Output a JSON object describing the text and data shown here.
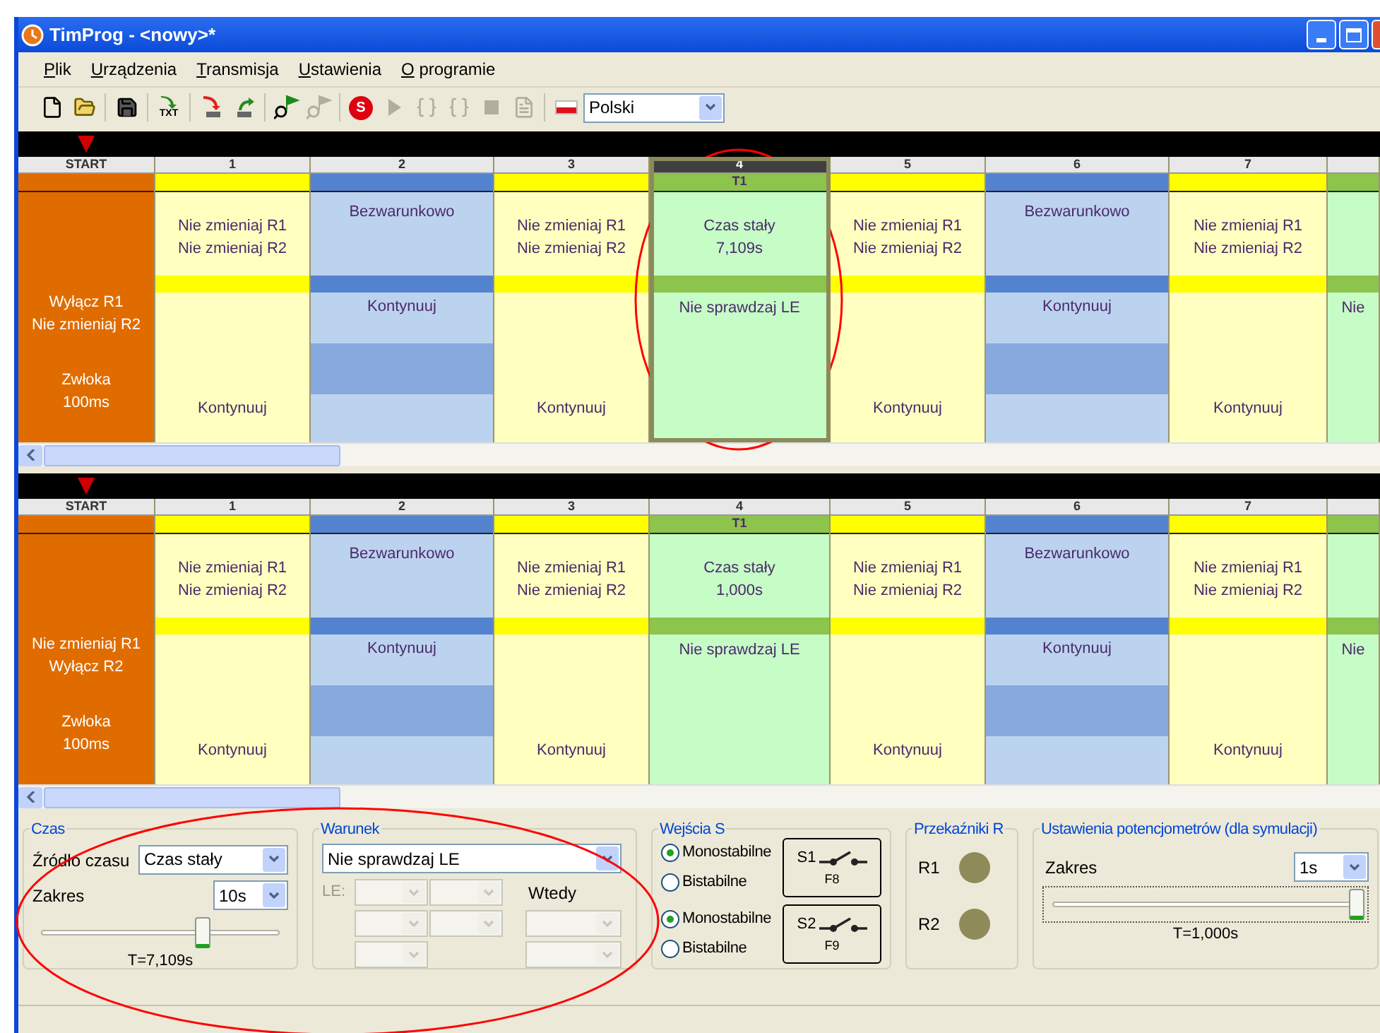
{
  "window": {
    "title": "TimProg - <nowy>*"
  },
  "menu": [
    "Plik",
    "Urządzenia",
    "Transmisja",
    "Ustawienia",
    "O programie"
  ],
  "toolbar": [
    {
      "kind": "new",
      "disabled": false
    },
    {
      "kind": "open",
      "disabled": false
    },
    {
      "kind": "separator"
    },
    {
      "kind": "save",
      "disabled": false
    },
    {
      "kind": "separator"
    },
    {
      "kind": "txt",
      "label": "TXT",
      "disabled": false
    },
    {
      "kind": "separator"
    },
    {
      "kind": "download",
      "disabled": false
    },
    {
      "kind": "upload",
      "disabled": false
    },
    {
      "kind": "separator"
    },
    {
      "kind": "find",
      "disabled": false
    },
    {
      "kind": "find",
      "disabled": true
    },
    {
      "kind": "separator"
    },
    {
      "kind": "stop",
      "label": "S",
      "disabled": false
    },
    {
      "kind": "play",
      "disabled": true
    },
    {
      "kind": "step-in",
      "disabled": true
    },
    {
      "kind": "step-out",
      "disabled": true
    },
    {
      "kind": "square",
      "disabled": true
    },
    {
      "kind": "doc",
      "disabled": true
    },
    {
      "kind": "separator"
    },
    {
      "kind": "flag",
      "disabled": false
    }
  ],
  "language": {
    "value": "Polski"
  },
  "programs": [
    {
      "columns": [
        {
          "kind": "start",
          "header": "START",
          "selected": false,
          "top": [
            "Wyłącz R1",
            "Nie zmieniaj R2"
          ],
          "bottom": [
            "Zwłoka",
            "100ms"
          ]
        },
        {
          "kind": "relay",
          "header": "1",
          "selected": false,
          "top": [
            "Nie zmieniaj R1",
            "Nie zmieniaj R2"
          ],
          "bottom": [
            "Kontynuuj"
          ]
        },
        {
          "kind": "condition",
          "header": "2",
          "selected": false,
          "top": [
            "Bezwarunkowo"
          ],
          "bottom": [
            "Kontynuuj"
          ]
        },
        {
          "kind": "relay",
          "header": "3",
          "selected": false,
          "top": [
            "Nie zmieniaj R1",
            "Nie zmieniaj R2"
          ],
          "bottom": [
            "Kontynuuj"
          ]
        },
        {
          "kind": "time",
          "header": "4",
          "tag": "T1",
          "selected": true,
          "top": [
            "Czas stały",
            "7,109s"
          ],
          "bottom": [
            "Nie sprawdzaj LE"
          ]
        },
        {
          "kind": "relay",
          "header": "5",
          "selected": false,
          "top": [
            "Nie zmieniaj R1",
            "Nie zmieniaj R2"
          ],
          "bottom": [
            "Kontynuuj"
          ]
        },
        {
          "kind": "condition",
          "header": "6",
          "selected": false,
          "top": [
            "Bezwarunkowo"
          ],
          "bottom": [
            "Kontynuuj"
          ]
        },
        {
          "kind": "relay",
          "header": "7",
          "selected": false,
          "top": [
            "Nie zmieniaj R1",
            "Nie zmieniaj R2"
          ],
          "bottom": [
            "Kontynuuj"
          ]
        },
        {
          "kind": "time",
          "selected": false,
          "bottom": [
            "Nie"
          ]
        }
      ]
    },
    {
      "columns": [
        {
          "kind": "start",
          "header": "START",
          "selected": false,
          "top": [
            "Nie zmieniaj R1",
            "Wyłącz R2"
          ],
          "bottom": [
            "Zwłoka",
            "100ms"
          ]
        },
        {
          "kind": "relay",
          "header": "1",
          "selected": false,
          "top": [
            "Nie zmieniaj R1",
            "Nie zmieniaj R2"
          ],
          "bottom": [
            "Kontynuuj"
          ]
        },
        {
          "kind": "condition",
          "header": "2",
          "selected": false,
          "top": [
            "Bezwarunkowo"
          ],
          "bottom": [
            "Kontynuuj"
          ]
        },
        {
          "kind": "relay",
          "header": "3",
          "selected": false,
          "top": [
            "Nie zmieniaj R1",
            "Nie zmieniaj R2"
          ],
          "bottom": [
            "Kontynuuj"
          ]
        },
        {
          "kind": "time",
          "header": "4",
          "tag": "T1",
          "selected": false,
          "top": [
            "Czas stały",
            "1,000s"
          ],
          "bottom": [
            "Nie sprawdzaj LE"
          ]
        },
        {
          "kind": "relay",
          "header": "5",
          "selected": false,
          "top": [
            "Nie zmieniaj R1",
            "Nie zmieniaj R2"
          ],
          "bottom": [
            "Kontynuuj"
          ]
        },
        {
          "kind": "condition",
          "header": "6",
          "selected": false,
          "top": [
            "Bezwarunkowo"
          ],
          "bottom": [
            "Kontynuuj"
          ]
        },
        {
          "kind": "relay",
          "header": "7",
          "selected": false,
          "top": [
            "Nie zmieniaj R1",
            "Nie zmieniaj R2"
          ],
          "bottom": [
            "Kontynuuj"
          ]
        },
        {
          "kind": "time",
          "selected": false,
          "bottom": [
            "Nie"
          ]
        }
      ]
    }
  ],
  "time_group": {
    "title": "Czas",
    "source_label": "Źródło czasu",
    "source": "Czas stały",
    "range_label": "Zakres",
    "range": "10s",
    "level": 0.68,
    "reading": "T=7,109s"
  },
  "condition_group": {
    "title": "Warunek",
    "condition": "Nie sprawdzaj LE",
    "le_label": "LE:",
    "disabled": true,
    "then_label": "Wtedy"
  },
  "inputs_group": {
    "title": "Wejścia S",
    "inputs": [
      {
        "radios": [
          {
            "label": "Monostabilne",
            "selected": true
          },
          {
            "label": "Bistabilne",
            "selected": false
          }
        ],
        "switch": "S1",
        "key": "F8"
      },
      {
        "radios": [
          {
            "label": "Monostabilne",
            "selected": true
          },
          {
            "label": "Bistabilne",
            "selected": false
          }
        ],
        "switch": "S2",
        "key": "F9"
      }
    ]
  },
  "relays_group": {
    "title": "Przekaźniki R",
    "relays": [
      {
        "label": "R1",
        "on": false
      },
      {
        "label": "R2",
        "on": false
      }
    ]
  },
  "pot_group": {
    "title": "Ustawienia potencjometrów (dla symulacji)",
    "range_label": "Zakres",
    "range": "1s",
    "level": 1,
    "reading": "T=1,000s"
  }
}
